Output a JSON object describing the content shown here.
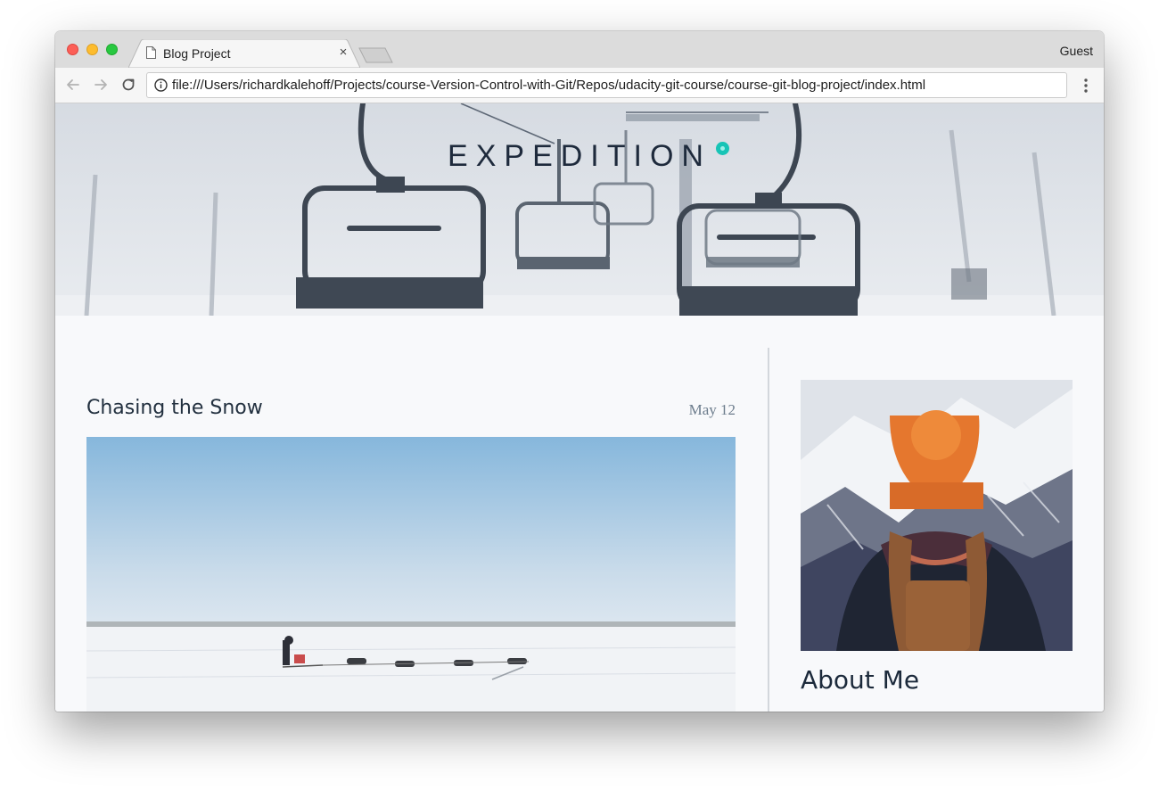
{
  "browser": {
    "tab": {
      "title": "Blog Project",
      "close_glyph": "×"
    },
    "profile_label": "Guest",
    "url": "file:///Users/richardkalehoff/Projects/course-Version-Control-with-Git/Repos/udacity-git-course/course-git-blog-project/index.html",
    "icons": [
      "back-arrow-icon",
      "forward-arrow-icon",
      "reload-icon",
      "info-icon",
      "menu-dots-icon",
      "document-icon"
    ]
  },
  "site": {
    "brand": "EXPEDITION",
    "accent_color": "#17c4b6",
    "post": {
      "title": "Chasing the Snow",
      "date": "May 12"
    },
    "sidebar": {
      "heading": "About Me"
    }
  }
}
